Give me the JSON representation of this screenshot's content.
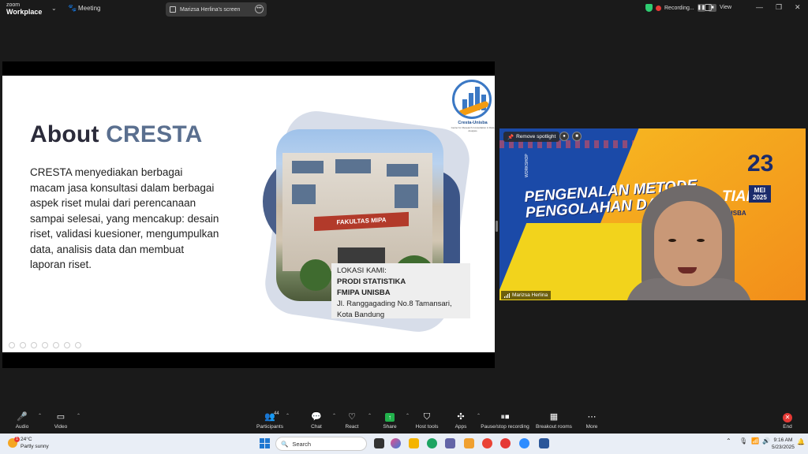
{
  "zoom": {
    "logo_line1": "zoom",
    "logo_line2": "Workplace",
    "meeting_label": "Meeting",
    "screen_label": "Marizsa Herlina's screen",
    "recording_label": "Recording...",
    "view_label": "View"
  },
  "slide": {
    "title_part1": "About",
    "title_part2": "CRESTA",
    "body": "CRESTA menyediakan berbagai macam jasa konsultasi dalam berbagai aspek riset mulai dari perencanaan sampai selesai, yang mencakup: desain riset, validasi kuesioner, mengumpulkan data, analisis data dan membuat laporan riset.",
    "building_sign": "FAKULTAS MIPA",
    "location": {
      "heading": "LOKASI KAMI:",
      "line1": "PRODI STATISTIKA",
      "line2": "FMIPA UNISBA",
      "line3": "Jl. Ranggagading No.8 Tamansari,",
      "line4": "Kota Bandung"
    },
    "logo_name": "Cresta-Unisba",
    "logo_sub": "Center for Research Consultation in Data Analysis"
  },
  "video": {
    "remove_spotlight": "Remove spotlight",
    "participant_name": "Marizsa Herlina",
    "banner_workshop": "WORKSHOP",
    "banner_line1": "PENGENALAN METODE",
    "banner_line2": "PENGOLAHAN DATA UNI",
    "banner_tian": "TIAN",
    "banner_day": "23",
    "banner_month": "MEI",
    "banner_year": "2025",
    "banner_unisba": "UNISBA"
  },
  "toolbar": {
    "audio": "Audio",
    "video": "Video",
    "participants": "Participants",
    "participants_count": "44",
    "chat": "Chat",
    "react": "React",
    "share": "Share",
    "host_tools": "Host tools",
    "apps": "Apps",
    "pause_recording": "Pause/stop recording",
    "breakout": "Breakout rooms",
    "more": "More",
    "end": "End"
  },
  "taskbar": {
    "weather_temp": "24°C",
    "weather_desc": "Partly sunny",
    "weather_badge": "1",
    "search_placeholder": "Search",
    "time": "9:16 AM",
    "date": "5/23/2025"
  },
  "colors": {
    "slide_accent": "#5a6f8f",
    "video_bg": "#1b4aa8",
    "banner_orange": "#f28c1a",
    "share_green": "#22b24c",
    "end_red": "#e53935"
  }
}
